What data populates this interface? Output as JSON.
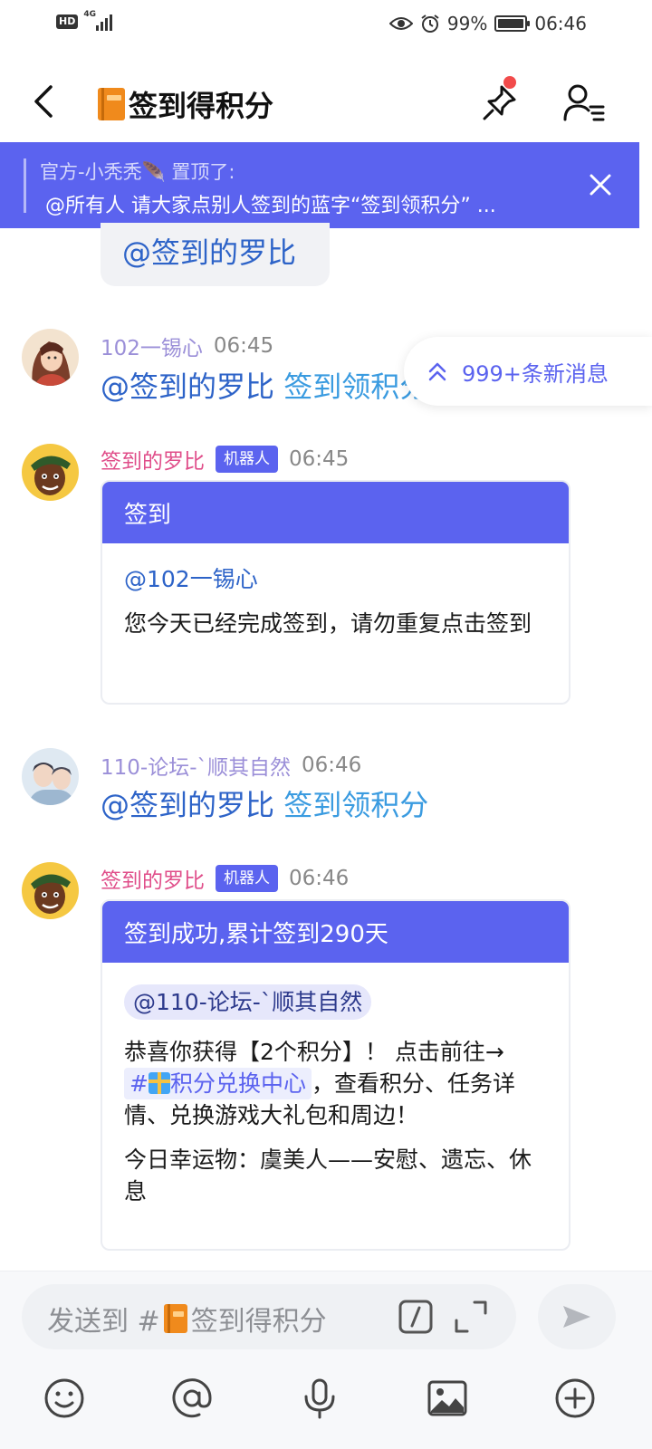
{
  "status_bar": {
    "hd_label": "HD",
    "network_label": "4G",
    "battery_text": "99%",
    "battery_level": 0.99,
    "time": "06:46"
  },
  "header": {
    "title": "签到得积分",
    "title_icon": "book-icon",
    "pin_has_dot": true,
    "accent_dot_color": "#f24b4b"
  },
  "pinned": {
    "line1": "官方-小秃秃🪶 置顶了:",
    "line2": "@所有人 请大家点别人签到的蓝字“签到领积分” ...",
    "background": "#5b63ef"
  },
  "new_messages": {
    "label": "999+条新消息"
  },
  "messages": [
    {
      "kind": "text_bubble_partial",
      "text": "@签到的罗比"
    },
    {
      "kind": "user",
      "name": "102一锡心",
      "time": "06:45",
      "mention": "@签到的罗比",
      "link": "签到领积分"
    },
    {
      "kind": "bot_card",
      "name": "签到的罗比",
      "tag": "机器人",
      "time": "06:45",
      "card_title": "签到",
      "mention": "@102一锡心",
      "body": "您今天已经完成签到，请勿重复点击签到"
    },
    {
      "kind": "user",
      "name": "110-论坛-ˋ顺其自然",
      "time": "06:46",
      "mention": "@签到的罗比",
      "link": "签到领积分"
    },
    {
      "kind": "bot_card",
      "name": "签到的罗比",
      "tag": "机器人",
      "time": "06:46",
      "card_title": "签到成功,累计签到290天",
      "mention": "@110-论坛-ˋ顺其自然",
      "body_before": "恭喜你获得【2个积分】！ 点击前往→",
      "hash_prefix": "#",
      "hash_label": "积分兑换中心",
      "body_after": "，查看积分、任务详情、兑换游戏大礼包和周边！",
      "lucky": "今日幸运物：虞美人——安慰、遗忘、休息"
    }
  ],
  "composer": {
    "placeholder_prefix": "发送到 #",
    "placeholder_channel": "签到得积分"
  },
  "toolbar": [
    "emoji-icon",
    "at-icon",
    "mic-icon",
    "image-icon",
    "plus-icon"
  ],
  "colors": {
    "accent": "#5b63ef",
    "bot_name": "#e04e8a",
    "user_name": "#9b8fd8",
    "mention": "#2d63c8",
    "link": "#3a9be0"
  }
}
